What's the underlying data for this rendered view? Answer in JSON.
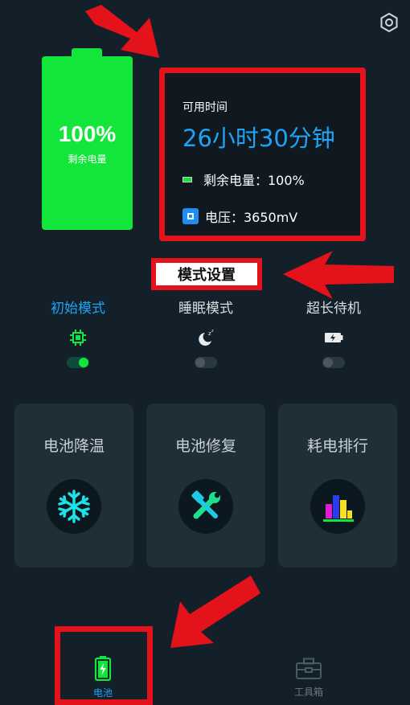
{
  "battery": {
    "percent_text": "100%",
    "label": "剩余电量",
    "level": 1.0
  },
  "info": {
    "available_label": "可用时间",
    "available_time": "26小时30分钟",
    "remaining": "剩余电量：100%",
    "voltage": "电压：3650mV"
  },
  "mode_section": {
    "title": "模式设置"
  },
  "modes": [
    {
      "name": "初始模式",
      "active": true,
      "icon": "chip-icon"
    },
    {
      "name": "睡眠模式",
      "active": false,
      "icon": "moon-icon"
    },
    {
      "name": "超长待机",
      "active": false,
      "icon": "battery-charge-icon"
    }
  ],
  "cards": [
    {
      "title": "电池降温",
      "icon": "snowflake-icon"
    },
    {
      "title": "电池修复",
      "icon": "wrench-hammer-icon"
    },
    {
      "title": "耗电排行",
      "icon": "bar-chart-icon"
    }
  ],
  "nav": [
    {
      "label": "电池",
      "icon": "battery-nav-icon",
      "active": true
    },
    {
      "label": "工具箱",
      "icon": "toolbox-icon",
      "active": false
    }
  ],
  "colors": {
    "background": "#13202a",
    "accent_green": "#12e63a",
    "accent_blue": "#1fa3f5",
    "annotation_red": "#e3121b"
  }
}
